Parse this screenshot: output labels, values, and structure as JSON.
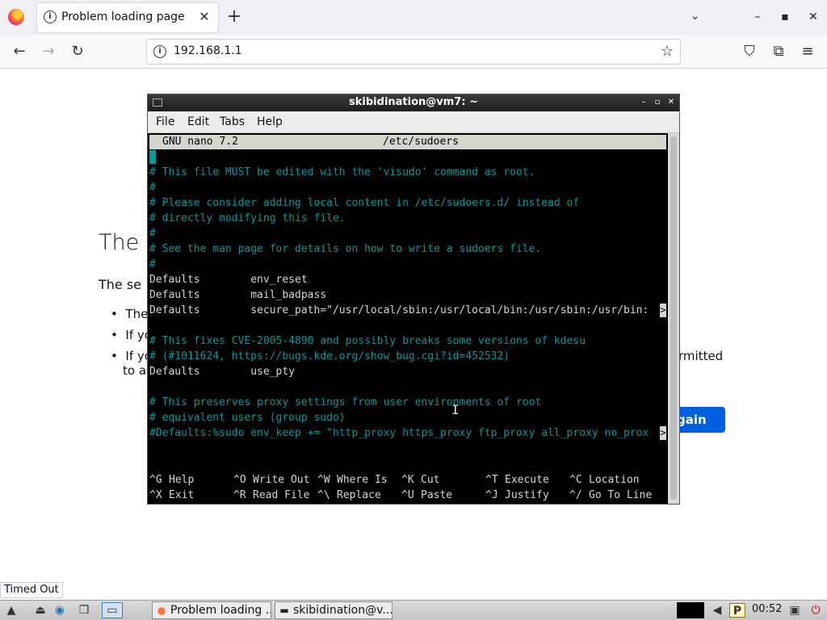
{
  "browser": {
    "tab_title": "Problem loading page",
    "tab_info_icon": "i",
    "tab_close": "✕",
    "new_tab": "+",
    "tab_list": "⌄",
    "win_min": "–",
    "win_max": "▪",
    "win_close": "✕",
    "url": "192.168.1.1",
    "url_info_icon": "i",
    "back": "←",
    "forward": "→",
    "reload": "↻",
    "star": "☆",
    "pocket": "⛉",
    "extensions": "⧉",
    "menu": "≡"
  },
  "page": {
    "title": "The",
    "body": "The se",
    "li1": "The",
    "li2": "If yo",
    "li3": "If yo",
    "li3b": "to a",
    "right_text": "rmitted",
    "try_again": "gain",
    "bullet": "•",
    "status": "Timed Out"
  },
  "terminal": {
    "title": "skibidination@vm7: ~",
    "btn_min": "–",
    "btn_max": "▫",
    "btn_close": "✕",
    "menus": [
      "File",
      "Edit",
      "Tabs",
      "Help"
    ],
    "nano_version": "GNU nano 7.2",
    "nano_file": "/etc/sudoers",
    "lines": [
      "#",
      "# This file MUST be edited with the 'visudo' command as root.",
      "#",
      "# Please consider adding local content in /etc/sudoers.d/ instead of",
      "# directly modifying this file.",
      "#",
      "# See the man page for details on how to write a sudoers file.",
      "#",
      "Defaults        env_reset",
      "Defaults        mail_badpass",
      "Defaults        secure_path=\"/usr/local/sbin:/usr/local/bin:/usr/sbin:/usr/bin:",
      "",
      "# This fixes CVE-2005-4890 and possibly breaks some versions of kdesu",
      "# (#1011624, https://bugs.kde.org/show_bug.cgi?id=452532)",
      "Defaults        use_pty",
      "",
      "# This preserves proxy settings from user environments of root",
      "# equivalent users (group sudo)",
      "#Defaults:%sudo env_keep += \"http_proxy https_proxy ftp_proxy all_proxy no_prox"
    ],
    "overflow_marker": ">",
    "shortcuts_row1": [
      {
        "key": "^G",
        "label": "Help"
      },
      {
        "key": "^O",
        "label": "Write Out"
      },
      {
        "key": "^W",
        "label": "Where Is"
      },
      {
        "key": "^K",
        "label": "Cut"
      },
      {
        "key": "^T",
        "label": "Execute"
      },
      {
        "key": "^C",
        "label": "Location"
      }
    ],
    "shortcuts_row2": [
      {
        "key": "^X",
        "label": "Exit"
      },
      {
        "key": "^R",
        "label": "Read File"
      },
      {
        "key": "^\\",
        "label": "Replace"
      },
      {
        "key": "^U",
        "label": "Paste"
      },
      {
        "key": "^J",
        "label": "Justify"
      },
      {
        "key": "^/",
        "label": "Go To Line"
      }
    ],
    "ibeam": "I"
  },
  "taskbar": {
    "task1": "Problem loading ...",
    "task2": "skibidination@v...",
    "clock": "00:52",
    "start_icon": "▲",
    "eject_icon": "⏏",
    "globe_icon": "◉",
    "windows_icon": "❐",
    "desktop_icon": "▭",
    "volume_icon": "◀",
    "tray_p_icon": "P",
    "tray_monitor_icon": "▣",
    "power_icon": "⏻",
    "task1_icon": "●",
    "task2_icon": "▬"
  },
  "colors": {
    "terminal_comment": "#06989a",
    "terminal_text": "#d3d7cf",
    "firefox_blue": "#0061e0"
  }
}
